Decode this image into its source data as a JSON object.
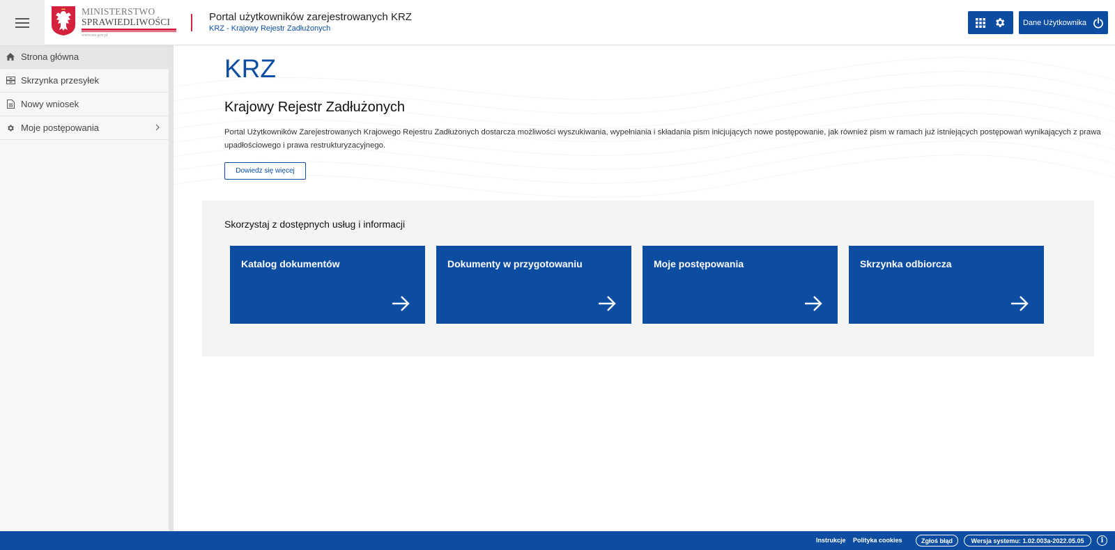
{
  "header": {
    "logo_line1": "MINISTERSTWO",
    "logo_line2": "SPRAWIEDLIWOŚCI",
    "logo_url": "www.ms.gov.pl",
    "portal_title": "Portal użytkowników zarejestrowanych KRZ",
    "portal_subtitle": "KRZ - Krajowy Rejestr Zadłużonych",
    "user_button_label": "Dane Użytkownika",
    "accent_color": "#0c4da2",
    "brand_red": "#d4213d"
  },
  "sidebar": {
    "items": [
      {
        "label": "Strona główna",
        "icon": "home-icon",
        "active": true
      },
      {
        "label": "Skrzynka przesyłek",
        "icon": "inbox-icon",
        "active": false
      },
      {
        "label": "Nowy wniosek",
        "icon": "document-icon",
        "active": false
      },
      {
        "label": "Moje postępowania",
        "icon": "gear-icon",
        "active": false,
        "has_submenu": true
      }
    ]
  },
  "main": {
    "title": "KRZ",
    "heading": "Krajowy Rejestr Zadłużonych",
    "description": "Portal Użytkowników Zarejestrowanych Krajowego Rejestru Zadłużonych dostarcza możliwości wyszukiwania, wypełniania i składania pism inicjujących nowe postępowanie, jak również pism w ramach już istniejących postępowań wynikających z prawa upadłościowego i prawa restrukturyzacyjnego.",
    "more_button": "Dowiedz się więcej",
    "services_title": "Skorzystaj z dostępnych usług i informacji",
    "tiles": [
      {
        "label": "Katalog dokumentów"
      },
      {
        "label": "Dokumenty w przygotowaniu"
      },
      {
        "label": "Moje postępowania"
      },
      {
        "label": "Skrzynka odbiorcza"
      }
    ]
  },
  "footer": {
    "instructions": "Instrukcje",
    "cookies": "Polityka cookies",
    "report_bug": "Zgłoś błąd",
    "version": "Wersja systemu: 1.02.003a-2022.05.05",
    "info_icon": "info-icon"
  }
}
